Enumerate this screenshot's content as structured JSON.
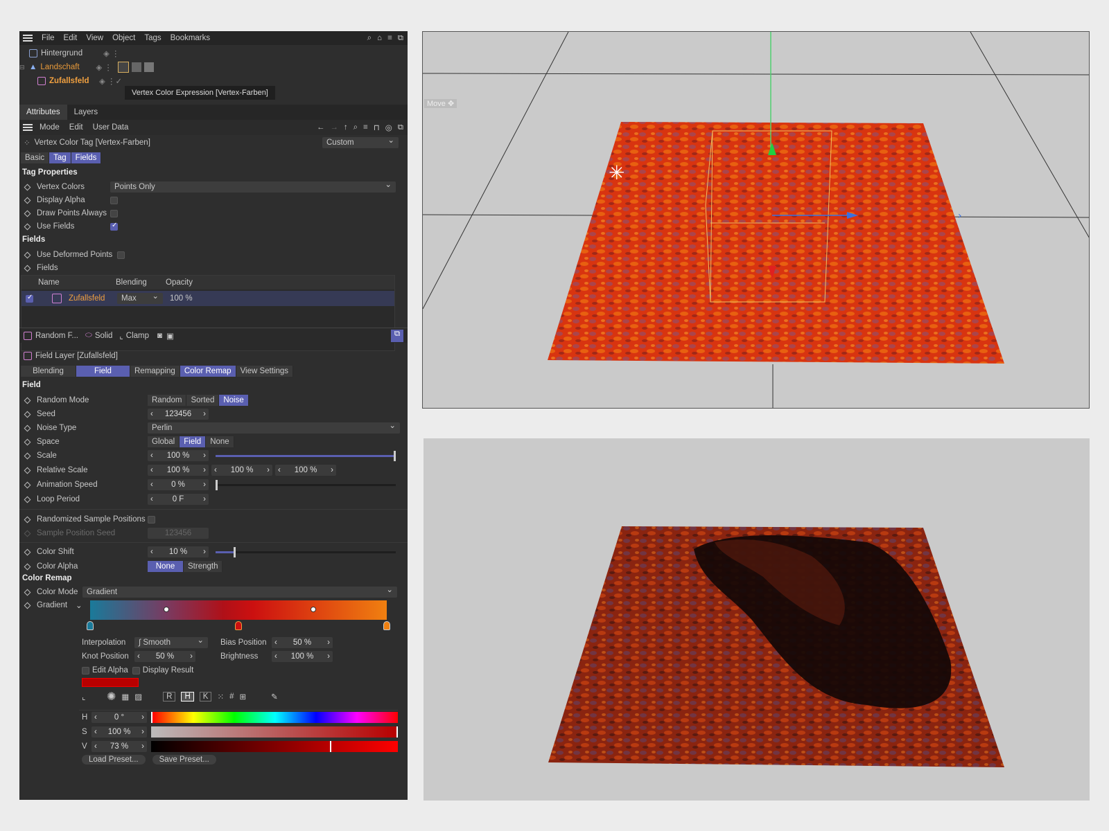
{
  "menu": {
    "items": [
      "File",
      "Edit",
      "View",
      "Object",
      "Tags",
      "Bookmarks"
    ]
  },
  "objects": [
    {
      "name": "Hintergrund"
    },
    {
      "name": "Landschaft"
    },
    {
      "name": "Zufallsfeld"
    }
  ],
  "tooltip": "Vertex Color Expression [Vertex-Farben]",
  "panel_tabs": {
    "attributes": "Attributes",
    "layers": "Layers"
  },
  "attr_menu": {
    "mode": "Mode",
    "edit": "Edit",
    "user_data": "User Data"
  },
  "tag_title": "Vertex Color Tag [Vertex-Farben]",
  "preset_select": "Custom",
  "tag_tabs": [
    "Basic",
    "Tag",
    "Fields"
  ],
  "tag_props": {
    "section": "Tag Properties",
    "vertex_colors_label": "Vertex Colors",
    "vertex_colors_value": "Points Only",
    "display_alpha": "Display Alpha",
    "draw_points": "Draw Points Always",
    "use_fields": "Use Fields"
  },
  "fields_section": {
    "title": "Fields",
    "use_deformed": "Use Deformed Points",
    "fields_label": "Fields"
  },
  "field_table": {
    "headers": [
      "Name",
      "Blending",
      "Opacity"
    ],
    "row": {
      "name": "Zufallsfeld",
      "blending": "Max",
      "opacity": "100 %"
    }
  },
  "layer_toolbar": {
    "random": "Random F...",
    "solid": "Solid",
    "clamp": "Clamp"
  },
  "field_layer_title": "Field Layer [Zufallsfeld]",
  "layer_tabs": [
    "Blending",
    "Field",
    "Remapping",
    "Color Remap",
    "View Settings"
  ],
  "field": {
    "section": "Field",
    "random_mode_label": "Random Mode",
    "modes": [
      "Random",
      "Sorted",
      "Noise"
    ],
    "seed_label": "Seed",
    "seed": "123456",
    "noise_type_label": "Noise Type",
    "noise_type": "Perlin",
    "space_label": "Space",
    "spaces": [
      "Global",
      "Field",
      "None"
    ],
    "scale_label": "Scale",
    "scale": "100 %",
    "rel_scale_label": "Relative Scale",
    "rel_scale": [
      "100 %",
      "100 %",
      "100 %"
    ],
    "anim_speed_label": "Animation Speed",
    "anim_speed": "0 %",
    "loop_label": "Loop Period",
    "loop": "0 F",
    "randomized_label": "Randomized Sample Positions",
    "sample_seed_label": "Sample Position Seed",
    "sample_seed": "123456",
    "color_shift_label": "Color Shift",
    "color_shift": "10 %",
    "color_alpha_label": "Color Alpha",
    "alpha_modes": [
      "None",
      "Strength"
    ]
  },
  "color_remap": {
    "section": "Color Remap",
    "mode_label": "Color Mode",
    "mode": "Gradient",
    "gradient_label": "Gradient",
    "interp_label": "Interpolation",
    "interp": "Smooth",
    "bias_label": "Bias Position",
    "bias": "50 %",
    "knot_label": "Knot Position",
    "knot": "50 %",
    "bright_label": "Brightness",
    "bright": "100 %",
    "edit_alpha": "Edit Alpha",
    "display_result": "Display Result",
    "swatch_color": "#b80000",
    "color_modes": [
      "R",
      "H",
      "K"
    ],
    "h_label": "H",
    "h": "0 °",
    "s_label": "S",
    "s": "100 %",
    "v_label": "V",
    "v": "73 %",
    "load": "Load Preset...",
    "save": "Save Preset..."
  },
  "viewport": {
    "move_label": "Move"
  },
  "colors": {
    "accent": "#5a5fb0",
    "orange": "#f0a040",
    "landscape_red": "#d83010"
  }
}
